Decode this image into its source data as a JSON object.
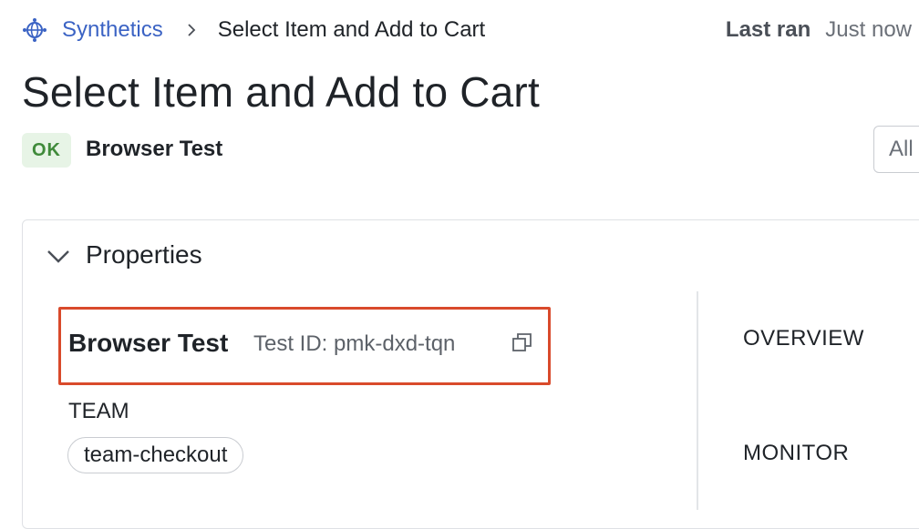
{
  "breadcrumb": {
    "root_icon": "synthetics-globe-icon",
    "root_label": "Synthetics",
    "separator_icon": "chevron-right-icon",
    "current_label": "Select Item and Add to Cart"
  },
  "last_ran": {
    "label": "Last ran",
    "value": "Just now"
  },
  "page_title": "Select Item and Add to Cart",
  "status": {
    "badge": "OK",
    "badge_color": "#3f8a3a",
    "test_type": "Browser Test"
  },
  "filter": {
    "value": "All"
  },
  "properties": {
    "toggle_icon": "chevron-down-icon",
    "heading": "Properties",
    "test_name": "Browser Test",
    "test_id": "Test ID: pmk-dxd-tqn",
    "copy_icon": "copy-icon",
    "team_label": "TEAM",
    "team_tag": "team-checkout",
    "right_sections": [
      "OVERVIEW",
      "MONITOR"
    ]
  },
  "colors": {
    "link": "#3b63c4",
    "highlight": "#d94a2b"
  }
}
